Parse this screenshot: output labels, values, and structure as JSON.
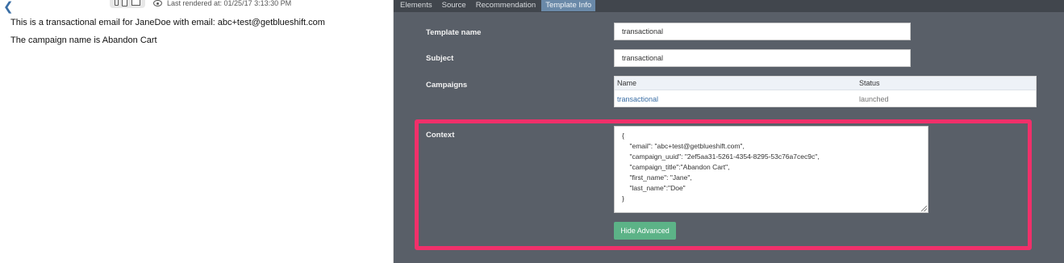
{
  "preview": {
    "back_icon": "chevron-left-icon",
    "device_icons": [
      "mobile-icon",
      "tablet-icon",
      "desktop-icon"
    ],
    "last_rendered": "Last rendered at: 01/25/17 3:13:30 PM",
    "lines": [
      "This is a transactional email for JaneDoe with email: abc+test@getblueshift.com",
      "The campaign name is Abandon Cart"
    ]
  },
  "tabs": [
    {
      "label": "Elements",
      "active": false
    },
    {
      "label": "Source",
      "active": false
    },
    {
      "label": "Recommendation",
      "active": false
    },
    {
      "label": "Template Info",
      "active": true
    }
  ],
  "form": {
    "template_name_label": "Template name",
    "template_name_value": "transactional",
    "subject_label": "Subject",
    "subject_value": "transactional",
    "campaigns_label": "Campaigns",
    "campaigns_columns": [
      "Name",
      "Status"
    ],
    "campaigns_rows": [
      {
        "name": "transactional",
        "status": "launched"
      }
    ],
    "context_label": "Context",
    "context_value": "{\n    \"email\": \"abc+test@getblueshift.com\",\n    \"campaign_uuid\": \"2ef5aa31-5261-4354-8295-53c76a7cec9c\",\n    \"campaign_title\":\"Abandon Cart\",\n    \"first_name\": \"Jane\",\n    \"last_name\":\"Doe\"\n}",
    "hide_advanced_label": "Hide Advanced"
  },
  "colors": {
    "panel_bg": "#595f68",
    "tab_bar_bg": "#41464d",
    "active_tab_bg": "#6a89a8",
    "highlight_border": "#f0306a",
    "button_green": "#5cb387",
    "link_blue": "#3a6ea5"
  }
}
